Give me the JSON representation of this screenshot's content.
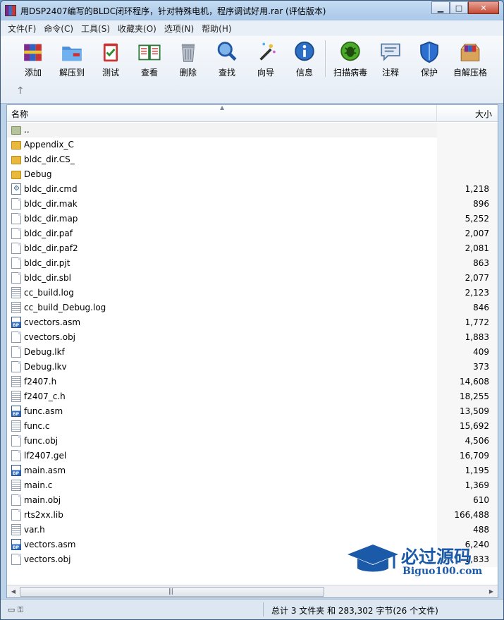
{
  "window": {
    "title": "用DSP2407编写的BLDC闭环程序，针对特殊电机，程序调试好用.rar (评估版本)"
  },
  "menu": [
    "文件(F)",
    "命令(C)",
    "工具(S)",
    "收藏夹(O)",
    "选项(N)",
    "帮助(H)"
  ],
  "toolbar": [
    {
      "label": "添加",
      "icon": "books-add-icon"
    },
    {
      "label": "解压到",
      "icon": "extract-folder-icon"
    },
    {
      "label": "测试",
      "icon": "clipboard-check-icon"
    },
    {
      "label": "查看",
      "icon": "open-book-icon"
    },
    {
      "label": "删除",
      "icon": "trash-can-icon"
    },
    {
      "label": "查找",
      "icon": "magnifier-icon"
    },
    {
      "label": "向导",
      "icon": "magic-wand-icon"
    },
    {
      "label": "信息",
      "icon": "info-icon"
    },
    {
      "label": "扫描病毒",
      "icon": "virus-scan-icon"
    },
    {
      "label": "注释",
      "icon": "comment-icon"
    },
    {
      "label": "保护",
      "icon": "shield-icon"
    },
    {
      "label": "自解压格",
      "icon": "sfx-box-icon"
    }
  ],
  "columns": {
    "name": "名称",
    "size": "大小"
  },
  "files": [
    {
      "name": "..",
      "size": "",
      "type": "parent"
    },
    {
      "name": "Appendix_C",
      "size": "",
      "type": "folder"
    },
    {
      "name": "bldc_dir.CS_",
      "size": "",
      "type": "folder"
    },
    {
      "name": "Debug",
      "size": "",
      "type": "folder"
    },
    {
      "name": "bldc_dir.cmd",
      "size": "1,218",
      "type": "cmd"
    },
    {
      "name": "bldc_dir.mak",
      "size": "896",
      "type": "doc"
    },
    {
      "name": "bldc_dir.map",
      "size": "5,252",
      "type": "doc"
    },
    {
      "name": "bldc_dir.paf",
      "size": "2,007",
      "type": "doc"
    },
    {
      "name": "bldc_dir.paf2",
      "size": "2,081",
      "type": "doc"
    },
    {
      "name": "bldc_dir.pjt",
      "size": "863",
      "type": "doc"
    },
    {
      "name": "bldc_dir.sbl",
      "size": "2,077",
      "type": "doc"
    },
    {
      "name": "cc_build.log",
      "size": "2,123",
      "type": "lines"
    },
    {
      "name": "cc_build_Debug.log",
      "size": "846",
      "type": "lines"
    },
    {
      "name": "cvectors.asm",
      "size": "1,772",
      "type": "bp"
    },
    {
      "name": "cvectors.obj",
      "size": "1,883",
      "type": "doc"
    },
    {
      "name": "Debug.lkf",
      "size": "409",
      "type": "doc"
    },
    {
      "name": "Debug.lkv",
      "size": "373",
      "type": "doc"
    },
    {
      "name": "f2407.h",
      "size": "14,608",
      "type": "lines"
    },
    {
      "name": "f2407_c.h",
      "size": "18,255",
      "type": "lines"
    },
    {
      "name": "func.asm",
      "size": "13,509",
      "type": "bp"
    },
    {
      "name": "func.c",
      "size": "15,692",
      "type": "lines"
    },
    {
      "name": "func.obj",
      "size": "4,506",
      "type": "doc"
    },
    {
      "name": "lf2407.gel",
      "size": "16,709",
      "type": "doc"
    },
    {
      "name": "main.asm",
      "size": "1,195",
      "type": "bp"
    },
    {
      "name": "main.c",
      "size": "1,369",
      "type": "lines"
    },
    {
      "name": "main.obj",
      "size": "610",
      "type": "doc"
    },
    {
      "name": "rts2xx.lib",
      "size": "166,488",
      "type": "doc"
    },
    {
      "name": "var.h",
      "size": "488",
      "type": "lines"
    },
    {
      "name": "vectors.asm",
      "size": "6,240",
      "type": "bp"
    },
    {
      "name": "vectors.obj",
      "size": "1,833",
      "type": "doc"
    }
  ],
  "status": {
    "summary": "总计 3 文件夹 和 283,302 字节(26 个文件)"
  },
  "watermark": {
    "cn": "必过源码",
    "en": "Biguo100.com"
  }
}
